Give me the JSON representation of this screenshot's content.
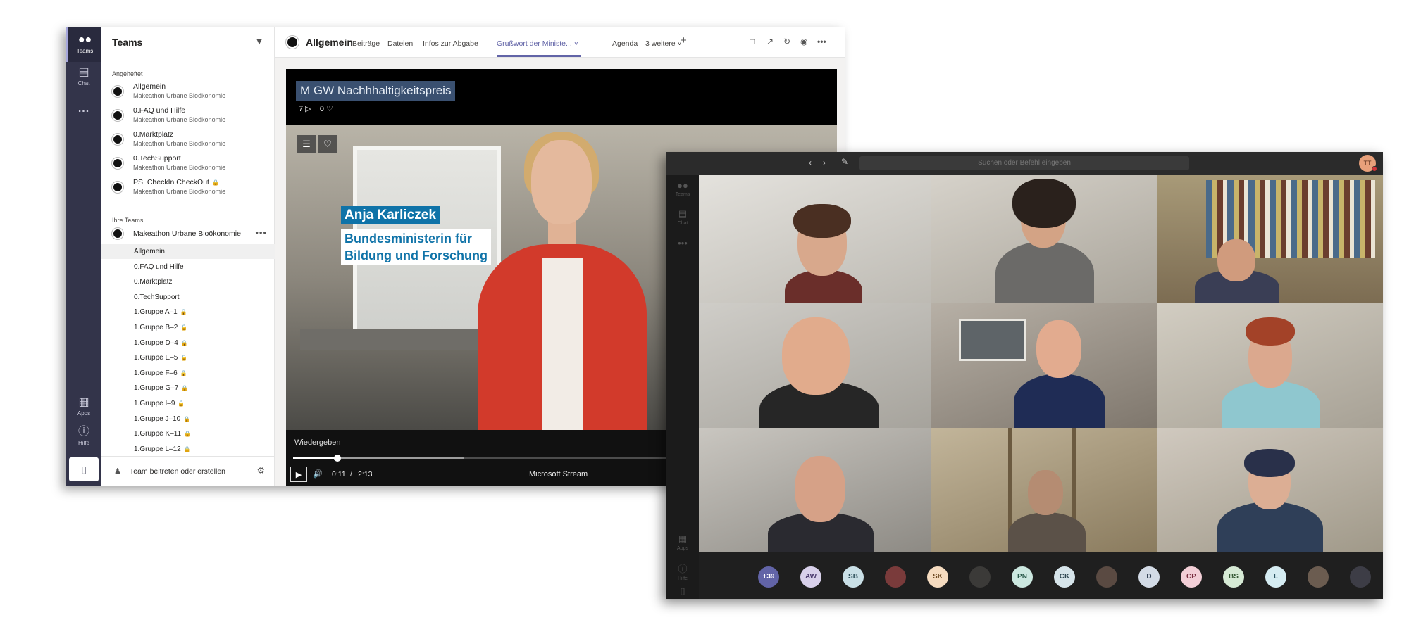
{
  "teams_window": {
    "rail": {
      "teams_label": "Teams",
      "chat_label": "Chat",
      "more_label": "...",
      "apps_label": "Apps",
      "help_label": "Hilfe"
    },
    "sidebar": {
      "title": "Teams",
      "pinned_label": "Angeheftet",
      "pinned": [
        {
          "name": "Allgemein",
          "team": "Makeathon Urbane Bioökonomie",
          "locked": false
        },
        {
          "name": "0.FAQ und Hilfe",
          "team": "Makeathon Urbane Bioökonomie",
          "locked": false
        },
        {
          "name": "0.Marktplatz",
          "team": "Makeathon Urbane Bioökonomie",
          "locked": false
        },
        {
          "name": "0.TechSupport",
          "team": "Makeathon Urbane Bioökonomie",
          "locked": false
        },
        {
          "name": "PS. CheckIn CheckOut",
          "team": "Makeathon Urbane Bioökonomie",
          "locked": true
        }
      ],
      "your_teams_label": "Ihre Teams",
      "team_name": "Makeathon Urbane Bioökonomie",
      "channels": [
        {
          "name": "Allgemein",
          "locked": false,
          "selected": true
        },
        {
          "name": "0.FAQ und Hilfe",
          "locked": false,
          "selected": false
        },
        {
          "name": "0.Marktplatz",
          "locked": false,
          "selected": false
        },
        {
          "name": "0.TechSupport",
          "locked": false,
          "selected": false
        },
        {
          "name": "1.Gruppe A–1",
          "locked": true,
          "selected": false
        },
        {
          "name": "1.Gruppe B–2",
          "locked": true,
          "selected": false
        },
        {
          "name": "1.Gruppe D–4",
          "locked": true,
          "selected": false
        },
        {
          "name": "1.Gruppe E–5",
          "locked": true,
          "selected": false
        },
        {
          "name": "1.Gruppe F–6",
          "locked": true,
          "selected": false
        },
        {
          "name": "1.Gruppe G–7",
          "locked": true,
          "selected": false
        },
        {
          "name": "1.Gruppe I–9",
          "locked": true,
          "selected": false
        },
        {
          "name": "1.Gruppe J–10",
          "locked": true,
          "selected": false
        },
        {
          "name": "1.Gruppe K–11",
          "locked": true,
          "selected": false
        },
        {
          "name": "1.Gruppe L–12",
          "locked": true,
          "selected": false
        }
      ],
      "join_label": "Team beitreten oder erstellen"
    },
    "header": {
      "channel_title": "Allgemein",
      "tabs": [
        {
          "label": "Beiträge",
          "active": false
        },
        {
          "label": "Dateien",
          "active": false
        },
        {
          "label": "Infos zur Abgabe",
          "active": false
        },
        {
          "label": "Grußwort der Ministe...",
          "active": true
        },
        {
          "label": "Agenda",
          "active": false
        },
        {
          "label": "3 weitere",
          "active": false
        }
      ],
      "add_tab": "+"
    },
    "video": {
      "title": "M GW Nachhhaltigkeitspreis",
      "views": "7",
      "likes": "0",
      "lower_third_name": "Anja Karliczek",
      "lower_third_role_1": "Bundesministerin für",
      "lower_third_role_2": "Bildung und Forschung",
      "play_label": "Wiedergeben",
      "time_current": "0:11",
      "time_separator": "/",
      "time_total": "2:13",
      "progress_fraction": 0.083,
      "source": "Microsoft Stream"
    }
  },
  "meeting_window": {
    "search_placeholder": "Suchen oder Befehl eingeben",
    "user_initials": "TT",
    "rail": {
      "teams_label": "Teams",
      "chat_label": "Chat",
      "apps_label": "Apps",
      "help_label": "Hilfe"
    },
    "participants": [
      {
        "label": "+39",
        "bg": "#6264a7",
        "fg": "#ffffff"
      },
      {
        "label": "AW",
        "bg": "#d8d0ea",
        "fg": "#4b3b6e"
      },
      {
        "label": "SB",
        "bg": "#c9dfe6",
        "fg": "#284a55"
      },
      {
        "label": "",
        "bg": "#7a3b3b",
        "fg": "#ffffff"
      },
      {
        "label": "SK",
        "bg": "#f6dcc0",
        "fg": "#6e4a23"
      },
      {
        "label": "",
        "bg": "#3b3a38",
        "fg": "#ffffff"
      },
      {
        "label": "PN",
        "bg": "#cce8e0",
        "fg": "#2a5a4b"
      },
      {
        "label": "CK",
        "bg": "#d6e4ea",
        "fg": "#2f4752"
      },
      {
        "label": "",
        "bg": "#5a4a42",
        "fg": "#ffffff"
      },
      {
        "label": "D",
        "bg": "#d3dbe6",
        "fg": "#2f3e52"
      },
      {
        "label": "CP",
        "bg": "#f3cfd7",
        "fg": "#7a2e40"
      },
      {
        "label": "BS",
        "bg": "#d6ead5",
        "fg": "#345733"
      },
      {
        "label": "L",
        "bg": "#d5ecf2",
        "fg": "#2b5462"
      },
      {
        "label": "",
        "bg": "#6b5c50",
        "fg": "#ffffff"
      },
      {
        "label": "",
        "bg": "#3d3d46",
        "fg": "#ffffff"
      }
    ]
  },
  "colors": {
    "teams_rail": "#33344a",
    "teams_accent": "#6264a7",
    "video_lower_third": "#0f73a8",
    "presence_busy": "#d13438"
  },
  "icons": {
    "teams": "teams-icon",
    "chat": "chat-icon",
    "apps": "apps-icon",
    "help": "help-icon",
    "filter": "filter-icon",
    "lock": "lock-icon",
    "settings": "gear-icon",
    "play": "play-icon",
    "volume": "volume-icon",
    "heart": "heart-icon"
  }
}
